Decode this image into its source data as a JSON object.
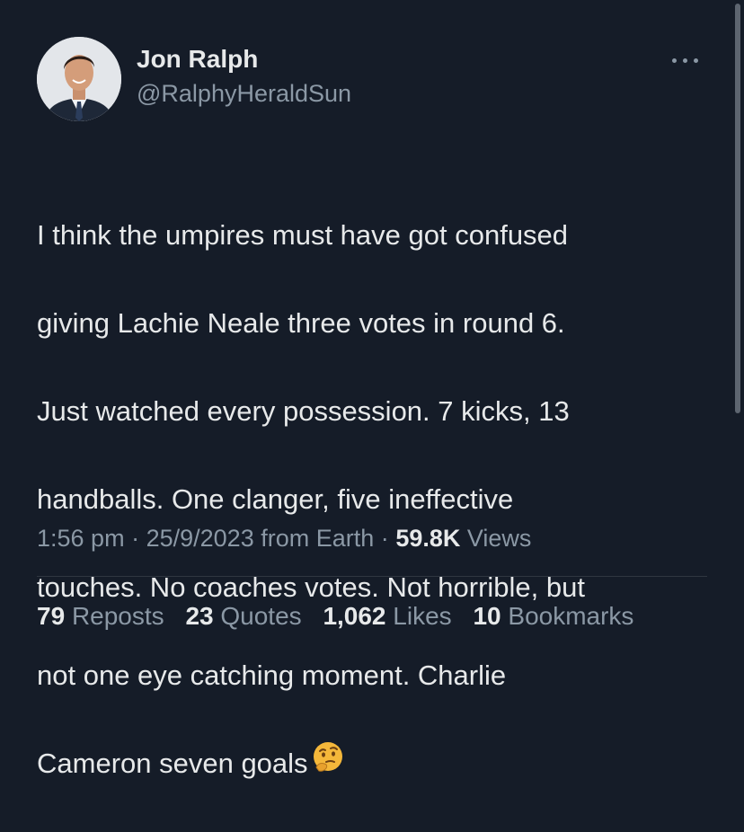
{
  "author": {
    "display_name": "Jon Ralph",
    "handle": "@RalphyHeraldSun"
  },
  "tweet": {
    "lines": [
      "I think the umpires must have got confused",
      "giving Lachie Neale three votes in round 6.",
      "Just watched every possession. 7 kicks, 13",
      "handballs. One clanger, five ineffective",
      "touches. No coaches votes. Not horrible, but",
      "not one eye catching moment. Charlie",
      "Cameron seven goals"
    ],
    "emoji": "thinking-face"
  },
  "meta": {
    "time": "1:56 pm",
    "sep": "·",
    "date": "25/9/2023",
    "source": "from Earth",
    "views_count": "59.8K",
    "views_label": "Views"
  },
  "stats": {
    "reposts_count": "79",
    "reposts_label": "Reposts",
    "quotes_count": "23",
    "quotes_label": "Quotes",
    "likes_count": "1,062",
    "likes_label": "Likes",
    "bookmarks_count": "10",
    "bookmarks_label": "Bookmarks"
  },
  "colors": {
    "background": "#151c28",
    "text": "#e7e9ea",
    "secondary": "#8b98a5"
  }
}
